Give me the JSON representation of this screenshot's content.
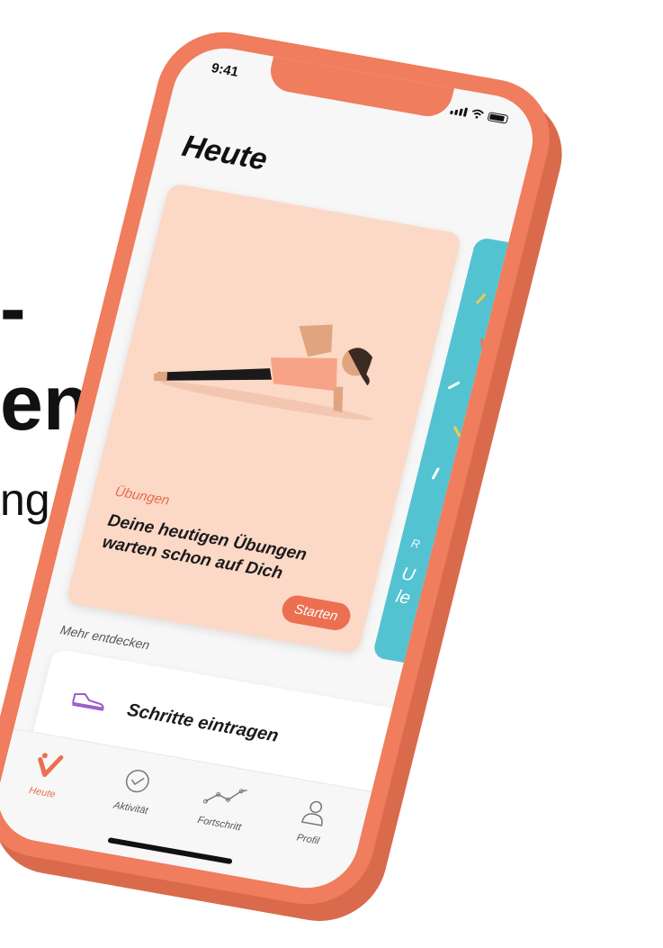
{
  "background_text": {
    "line1": "-",
    "line2": "en",
    "line3": "ng"
  },
  "status_bar": {
    "time": "9:41"
  },
  "page": {
    "title": "Heute"
  },
  "main_card": {
    "kicker": "Übungen",
    "title": "Deine heutigen Übungen warten schon auf Dich",
    "button_label": "Starten"
  },
  "secondary_card": {
    "kicker": "R",
    "text": "U\nle"
  },
  "more": {
    "label": "Mehr entdecken",
    "steps_label": "Schritte eintragen"
  },
  "tabbar": {
    "items": [
      {
        "label": "Heute",
        "icon": "v-logo-icon",
        "active": true
      },
      {
        "label": "Aktivität",
        "icon": "check-circle-icon",
        "active": false
      },
      {
        "label": "Fortschritt",
        "icon": "progress-chart-icon",
        "active": false
      },
      {
        "label": "Profil",
        "icon": "profile-icon",
        "active": false
      }
    ]
  },
  "colors": {
    "phone_frame": "#ef7d5e",
    "card_peach": "#fcd9c7",
    "card_teal": "#54c3d1",
    "accent": "#ec6f52",
    "shoe_purple": "#9b59c9"
  }
}
